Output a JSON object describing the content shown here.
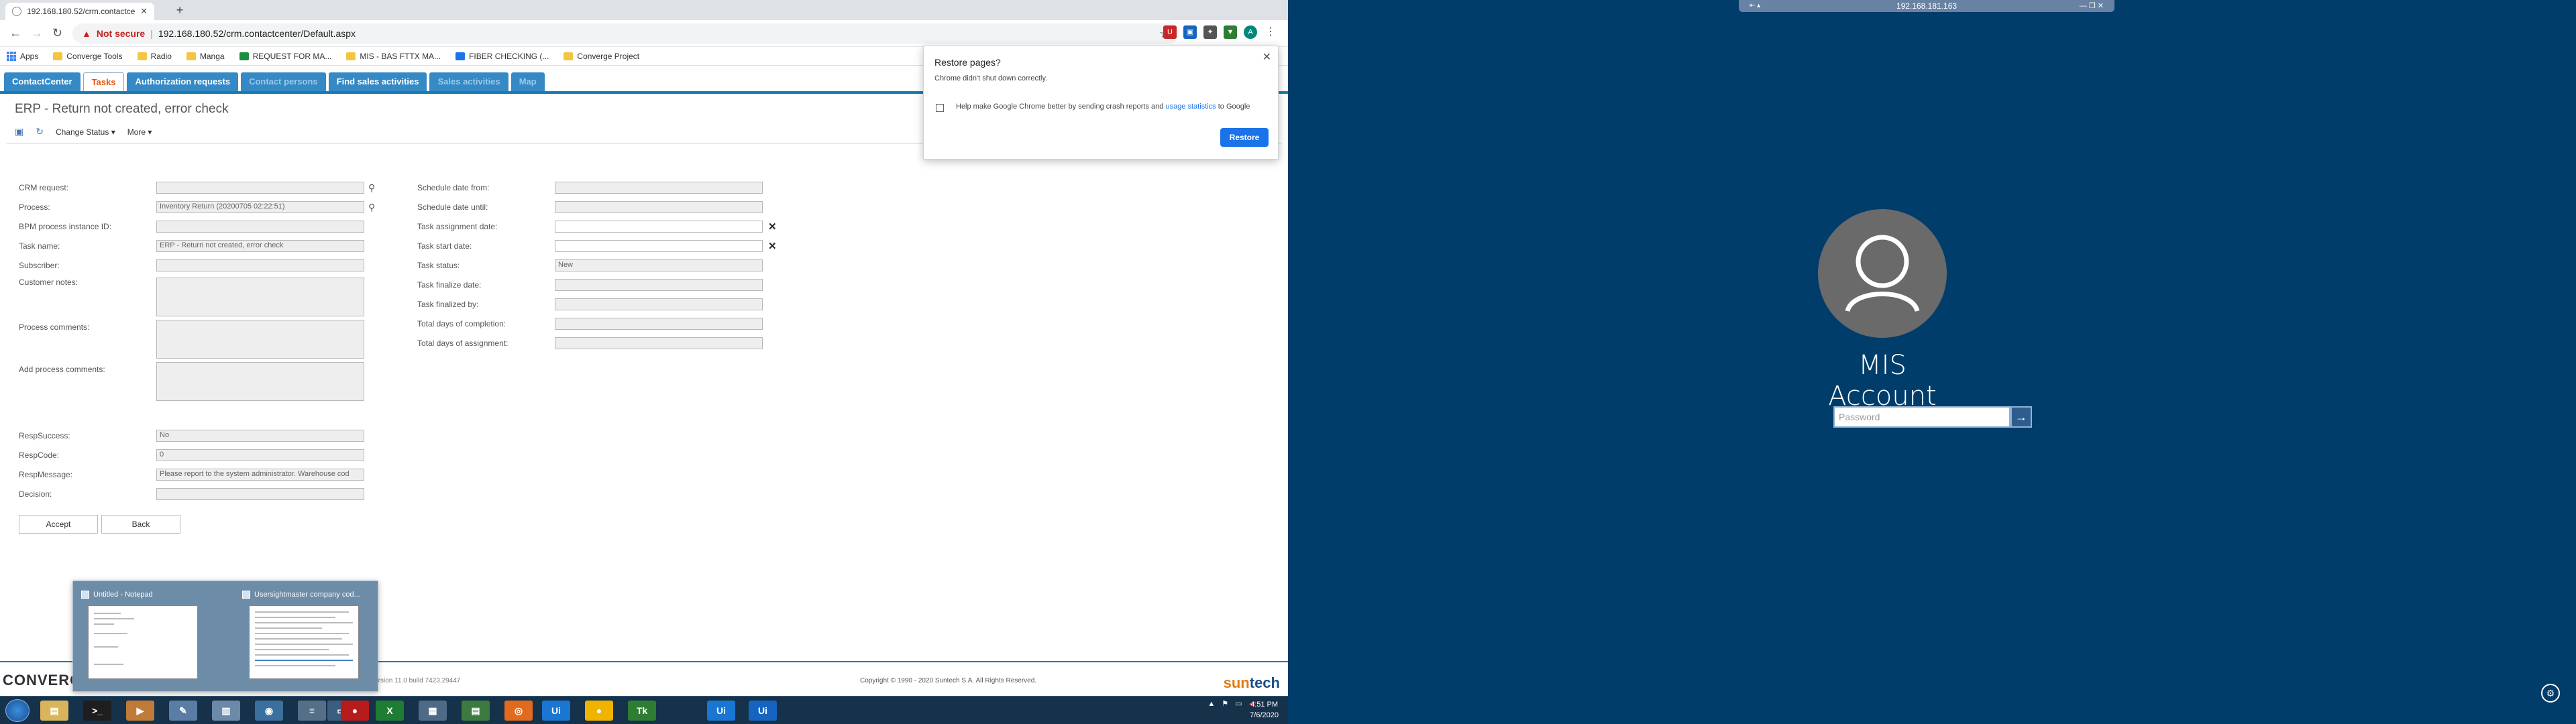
{
  "browser": {
    "tab_title": "192.168.180.52/crm.contactcente",
    "not_secure": "Not secure",
    "url": "192.168.180.52/crm.contactcenter/Default.aspx",
    "profile_initial": "A"
  },
  "bookmarks": [
    {
      "label": "Apps",
      "icon": "apps"
    },
    {
      "label": "Converge Tools",
      "icon": "folder"
    },
    {
      "label": "Radio",
      "icon": "folder"
    },
    {
      "label": "Manga",
      "icon": "folder"
    },
    {
      "label": "REQUEST FOR MA...",
      "icon": "sheet"
    },
    {
      "label": "MIS - BAS FTTX MA...",
      "icon": "folder"
    },
    {
      "label": "FIBER CHECKING (...",
      "icon": "doc"
    },
    {
      "label": "Converge Project",
      "icon": "folder"
    }
  ],
  "crm": {
    "tabs": [
      {
        "label": "ContactCenter",
        "state": "normal"
      },
      {
        "label": "Tasks",
        "state": "active"
      },
      {
        "label": "Authorization requests",
        "state": "normal"
      },
      {
        "label": "Contact persons",
        "state": "dim"
      },
      {
        "label": "Find sales activities",
        "state": "normal"
      },
      {
        "label": "Sales activities",
        "state": "dim"
      },
      {
        "label": "Map",
        "state": "dim"
      }
    ],
    "page_title": "ERP - Return not created, error check",
    "toolbar": {
      "change_status": "Change Status ▾",
      "more": "More ▾"
    },
    "left_fields": [
      {
        "label": "CRM request:",
        "value": "",
        "lens": true
      },
      {
        "label": "Process:",
        "value": "Inventory Return (20200705 02:22:51)",
        "lens": true
      },
      {
        "label": "BPM process instance ID:",
        "value": ""
      },
      {
        "label": "Task name:",
        "value": "ERP - Return not created, error check"
      },
      {
        "label": "Subscriber:",
        "value": ""
      }
    ],
    "notes": [
      {
        "label": "Customer notes:",
        "value": ""
      },
      {
        "label": "Process comments:",
        "value": ""
      },
      {
        "label": "Add process comments:",
        "value": ""
      }
    ],
    "resp_fields": [
      {
        "label": "RespSuccess:",
        "value": "No"
      },
      {
        "label": "RespCode:",
        "value": "0"
      },
      {
        "label": "RespMessage:",
        "value": "Please report to the system administrator. Warehouse cod"
      },
      {
        "label": "Decision:",
        "value": ""
      }
    ],
    "right_fields": [
      {
        "label": "Schedule date from:",
        "value": ""
      },
      {
        "label": "Schedule date until:",
        "value": ""
      },
      {
        "label": "Task assignment date:",
        "value": "",
        "clear": true
      },
      {
        "label": "Task start date:",
        "value": "",
        "clear": true
      },
      {
        "label": "Task status:",
        "value": "New"
      },
      {
        "label": "Task finalize date:",
        "value": ""
      },
      {
        "label": "Task finalized by:",
        "value": ""
      },
      {
        "label": "Total days of completion:",
        "value": ""
      },
      {
        "label": "Total days of assignment:",
        "value": ""
      }
    ],
    "buttons": {
      "accept": "Accept",
      "back": "Back"
    },
    "footer": {
      "version": "Version 11.0 build 7423.29447",
      "copyright": "Copyright © 1990 - 2020 Suntech S.A. All Rights Reserved.",
      "converge_logo": "CONVERGE",
      "suntech_logo_a": "sun",
      "suntech_logo_b": "tech"
    }
  },
  "restore_popup": {
    "title": "Restore pages?",
    "body": "Chrome didn't shut down correctly.",
    "checkbox_prefix": "Help make Google Chrome better by sending crash reports and",
    "checkbox_link": "usage statistics",
    "checkbox_suffix": "to Google",
    "restore": "Restore"
  },
  "thumbnails": [
    {
      "title": "Untitled - Notepad"
    },
    {
      "title": "Usersightmaster company cod..."
    }
  ],
  "taskbar": {
    "clock_time": "4:51 PM",
    "clock_date": "7/6/2020",
    "items": [
      "explorer",
      "cmd",
      "media",
      "paint",
      "files",
      "chrome",
      "stack",
      "tablet",
      "record",
      "excel",
      "sheet",
      "calc",
      "ubuntu",
      "ui1",
      "yellow",
      "ticket",
      "ui2",
      "ui3"
    ]
  },
  "remote": {
    "title": "192.168.181.163",
    "user_name": "MIS Account",
    "password_placeholder": "Password"
  },
  "colors": {
    "crm_blue": "#3589c4",
    "active_tab_text": "#e3560e",
    "lock_bg": "#013d6b",
    "restore_btn": "#1a73e8"
  }
}
